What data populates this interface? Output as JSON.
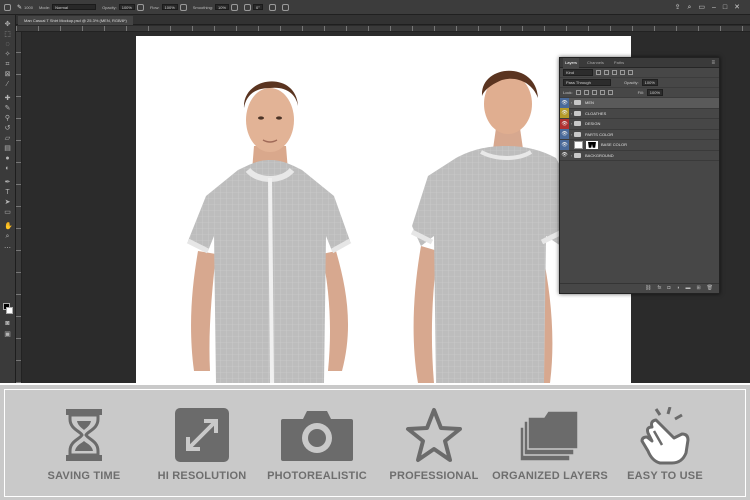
{
  "app": {
    "name": "Photoshop",
    "document_tab": "Man Casual T Shirt Mockup.psd @ 25.3% (MEN, RGB/8*)"
  },
  "options_bar": {
    "mode_label": "Mode:",
    "mode_value": "Normal",
    "opacity_label": "Opacity:",
    "opacity_value": "100%",
    "flow_label": "Flow:",
    "flow_value": "100%",
    "smoothing_label": "Smoothing:",
    "smoothing_value": "10%",
    "angle_value": "0°",
    "brush_size": "1000"
  },
  "layers_panel": {
    "tabs": [
      "Layers",
      "Channels",
      "Paths"
    ],
    "filter_label": "Kind",
    "blend_mode": "Pass Through",
    "opacity_label": "Opacity:",
    "opacity_value": "100%",
    "lock_label": "Lock:",
    "fill_label": "Fill:",
    "fill_value": "100%",
    "layers": [
      {
        "name": "MEN",
        "kind": "folder",
        "tag_color": "#4a6a9a",
        "selected": true
      },
      {
        "name": "CLOATHES",
        "kind": "folder",
        "tag_color": "#b59a2a",
        "selected": false
      },
      {
        "name": "DESIGN",
        "kind": "folder",
        "tag_color": "#b03030",
        "selected": false
      },
      {
        "name": "PARTS COLOR",
        "kind": "folder",
        "tag_color": "#4a6a9a",
        "selected": false
      },
      {
        "name": "BASE COLOR",
        "kind": "masked-layer",
        "tag_color": "#4a6a9a",
        "selected": false
      },
      {
        "name": "BACKGROUND",
        "kind": "folder",
        "tag_color": "#474747",
        "selected": false
      }
    ]
  },
  "features": [
    {
      "label": "SAVING TIME",
      "icon": "hourglass-icon"
    },
    {
      "label": "HI RESOLUTION",
      "icon": "expand-arrows-icon"
    },
    {
      "label": "PHOTOREALISTIC",
      "icon": "camera-icon"
    },
    {
      "label": "PROFESSIONAL",
      "icon": "star-icon"
    },
    {
      "label": "ORGANIZED LAYERS",
      "icon": "stacked-layers-icon"
    },
    {
      "label": "EASY TO USE",
      "icon": "hand-tap-icon"
    }
  ],
  "colors": {
    "feature_icon": "#6b6b6b",
    "feature_strip": "#c9c9c9",
    "ps_ui": "#2b2b2b"
  }
}
